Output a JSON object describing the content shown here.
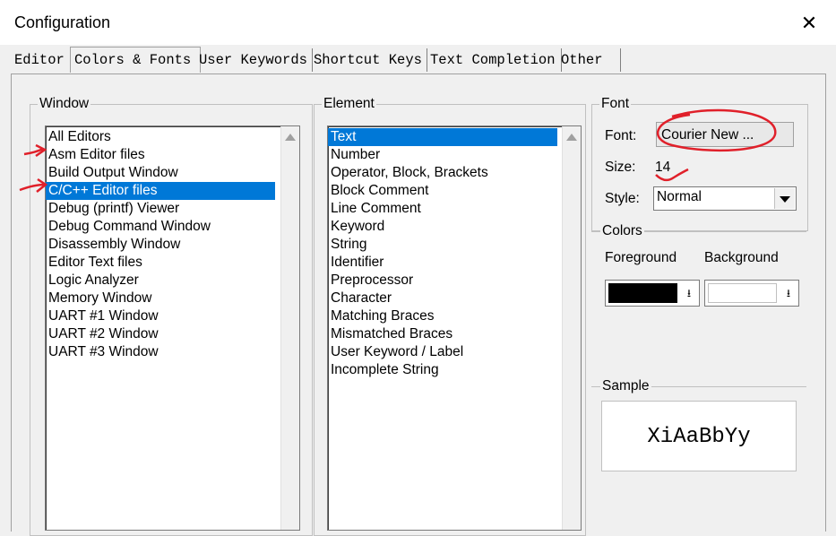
{
  "window": {
    "title": "Configuration",
    "close_glyph": "✕"
  },
  "tabs": [
    {
      "label": "Editor"
    },
    {
      "label": "Colors & Fonts"
    },
    {
      "label": "User Keywords"
    },
    {
      "label": "Shortcut Keys"
    },
    {
      "label": "Text Completion"
    },
    {
      "label": "Other"
    }
  ],
  "active_tab": "Colors & Fonts",
  "window_group": {
    "label": "Window",
    "items": [
      "All Editors",
      "Asm Editor files",
      "Build Output Window",
      "C/C++ Editor files",
      "Debug (printf) Viewer",
      "Debug Command Window",
      "Disassembly Window",
      "Editor Text files",
      "Logic Analyzer",
      "Memory Window",
      "UART #1 Window",
      "UART #2 Window",
      "UART #3 Window"
    ],
    "selected": "C/C++ Editor files"
  },
  "element_group": {
    "label": "Element",
    "items": [
      "Text",
      "Number",
      "Operator, Block, Brackets",
      "Block Comment",
      "Line Comment",
      "Keyword",
      "String",
      "Identifier",
      "Preprocessor",
      "Character",
      "Matching Braces",
      "Mismatched Braces",
      "User Keyword / Label",
      "Incomplete String"
    ],
    "selected": "Text"
  },
  "font_group": {
    "label": "Font",
    "font_label": "Font:",
    "font_button": "Courier New ...",
    "size_label": "Size:",
    "size_value": "14",
    "style_label": "Style:",
    "style_value": "Normal"
  },
  "colors_group": {
    "label": "Colors",
    "foreground_label": "Foreground",
    "background_label": "Background",
    "foreground_color": "#000000",
    "background_color": "#ffffff",
    "dropdown_glyph": "⭳"
  },
  "sample_group": {
    "label": "Sample",
    "text": "XiAaBbYy"
  },
  "annotations": {
    "color": "#e0202a"
  },
  "accent": "#0078d7"
}
